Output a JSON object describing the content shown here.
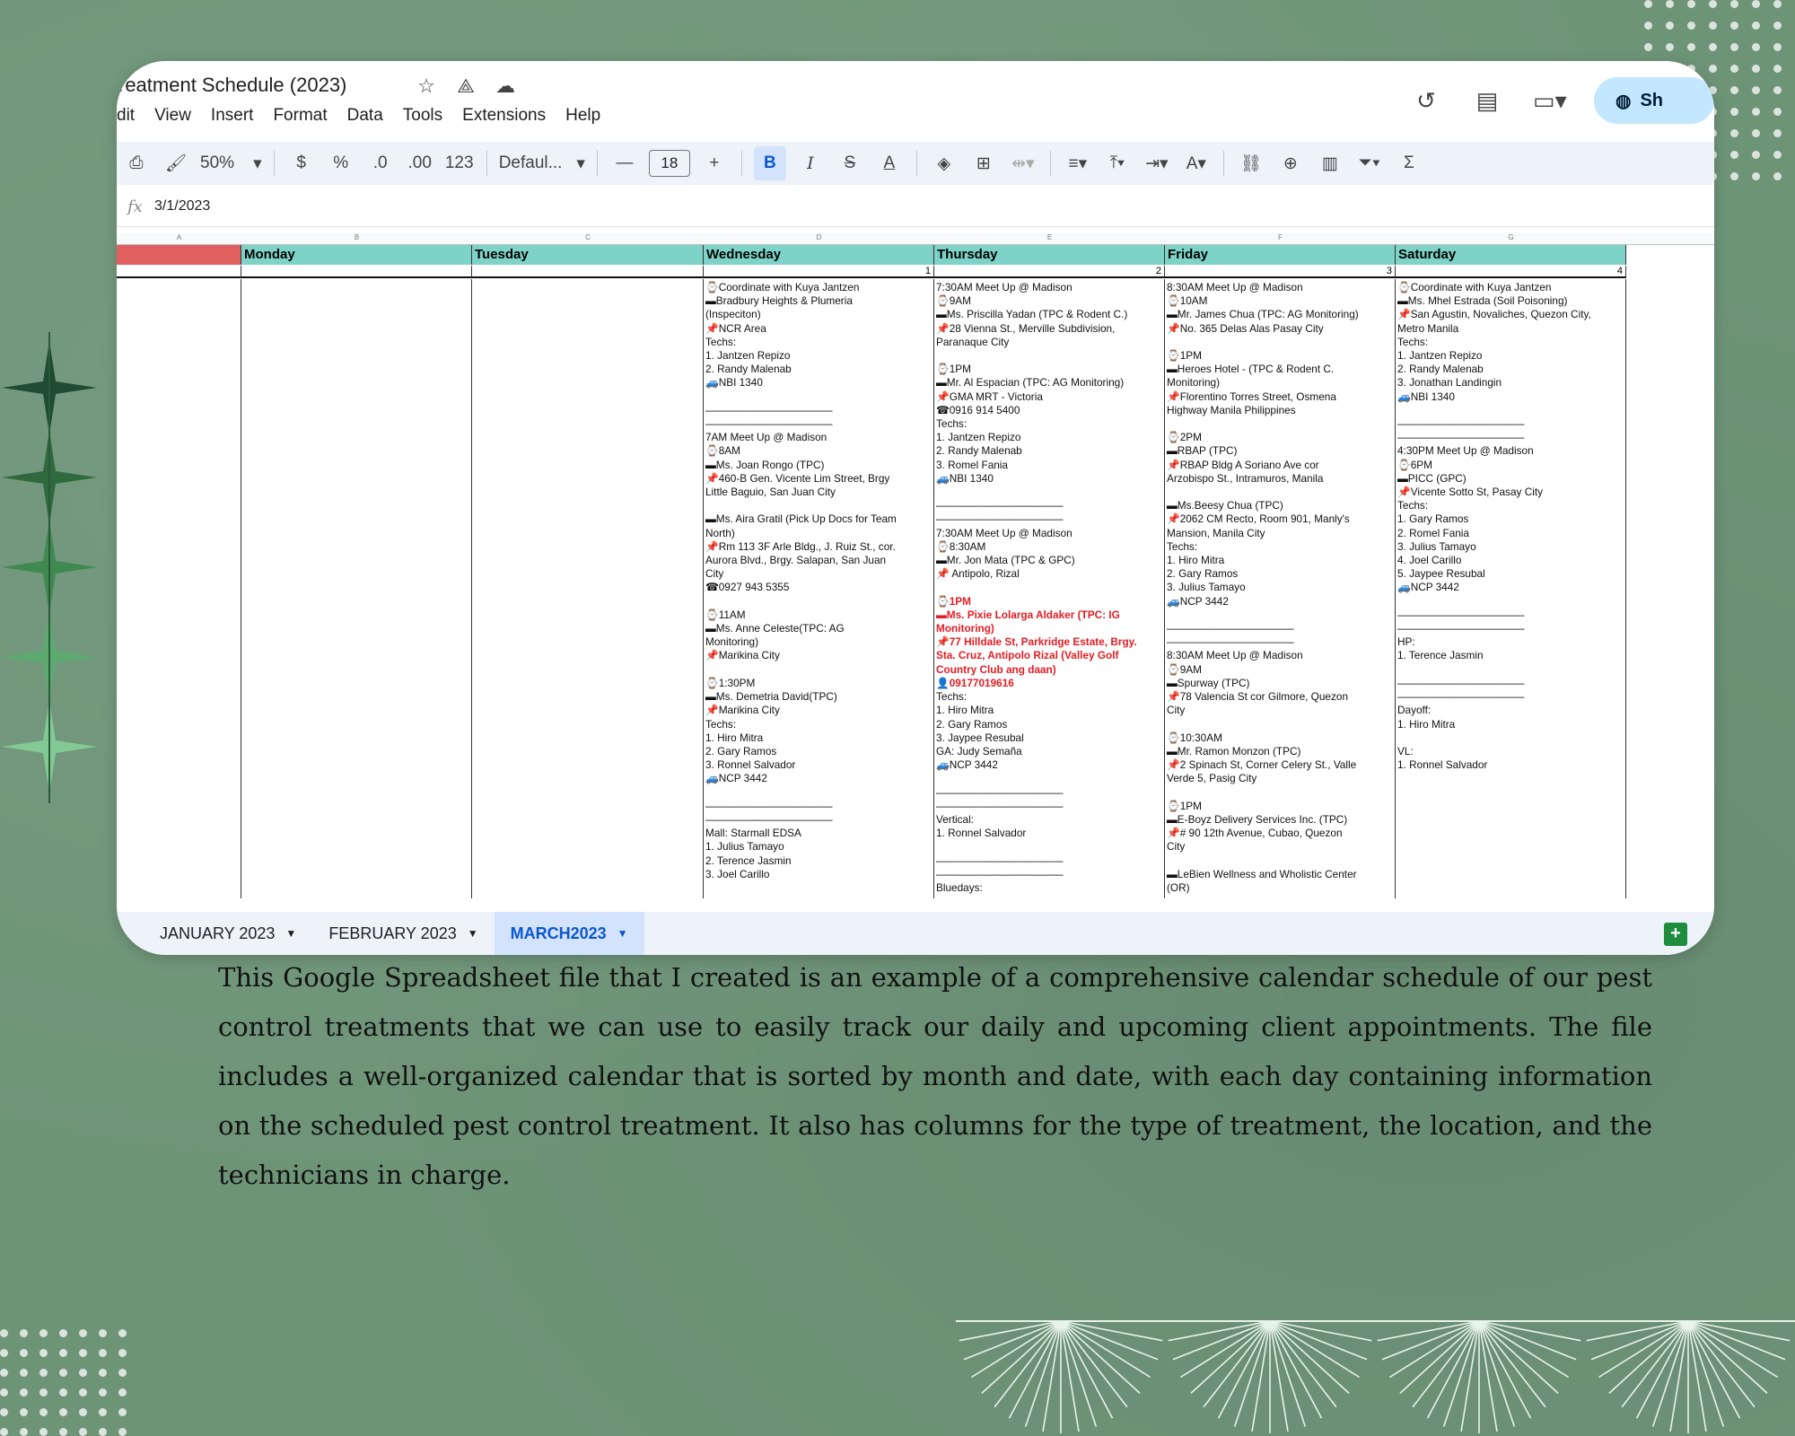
{
  "window": {
    "doc_title": "reatment Schedule (2023)",
    "menu": [
      "dit",
      "View",
      "Insert",
      "Format",
      "Data",
      "Tools",
      "Extensions",
      "Help"
    ],
    "share_label": "Sh"
  },
  "toolbar": {
    "zoom": "50%",
    "currency": "$",
    "percent": "%",
    "dec_decrease": ".0",
    "dec_increase": ".00",
    "number_format": "123",
    "font": "Defaul...",
    "font_size": "18"
  },
  "formula_bar": {
    "fx": "fx",
    "value": "3/1/2023"
  },
  "grid": {
    "column_letters": [
      "A",
      "B",
      "C",
      "D",
      "E",
      "F",
      "G"
    ],
    "days": [
      "",
      "Monday",
      "Tuesday",
      "Wednesday",
      "Thursday",
      "Friday",
      "Saturday"
    ],
    "dates": [
      "",
      "",
      "",
      "1",
      "2",
      "3",
      "4"
    ],
    "cells": {
      "wednesday": [
        "⌚Coordinate with Kuya Jantzen",
        "▬Bradbury Heights & Plumeria",
        "(Inspeciton)",
        "📌NCR Area",
        "Techs:",
        "1. Jantzen Repizo",
        "2. Randy Malenab",
        "🚙NBI 1340",
        "",
        "————————————",
        "————————————",
        "7AM Meet Up @ Madison",
        "⌚8AM",
        "▬Ms. Joan Rongo (TPC)",
        "📌460-B Gen. Vicente Lim Street, Brgy",
        "Little Baguio, San Juan City",
        "",
        "▬Ms. Aira Gratil (Pick Up Docs for Team",
        "North)",
        "📌Rm 113 3F Arle Bldg., J. Ruiz St., cor.",
        "Aurora Blvd., Brgy. Salapan, San Juan",
        "City",
        "☎0927 943 5355",
        "",
        "⌚11AM",
        "▬Ms. Anne Celeste(TPC: AG",
        "Monitoring)",
        "📌Marikina City",
        "",
        "⌚1:30PM",
        "▬Ms. Demetria David(TPC)",
        "📌Marikina City",
        "Techs:",
        "1. Hiro Mitra",
        "2. Gary Ramos",
        "3. Ronnel Salvador",
        "🚙NCP 3442",
        "",
        "————————————",
        "————————————",
        "Mall: Starmall EDSA",
        "1. Julius Tamayo",
        "2. Terence Jasmin",
        "3. Joel Carillo"
      ],
      "thursday": [
        "7:30AM Meet Up @ Madison",
        "⌚9AM",
        "▬Ms. Priscilla Yadan (TPC & Rodent C.)",
        "📌28 Vienna St., Merville Subdivision,",
        "Paranaque City",
        "",
        "⌚1PM",
        "▬Mr. Al Espacian (TPC: AG Monitoring)",
        "📌GMA MRT - Victoria",
        "☎0916 914 5400",
        "Techs:",
        "1. Jantzen Repizo",
        "2. Randy Malenab",
        "3. Romel Fania",
        "🚙NBI 1340",
        "",
        "————————————",
        "————————————",
        "7:30AM Meet Up @ Madison",
        "⌚8:30AM",
        "▬Mr. Jon Mata (TPC & GPC)",
        "📌 Antipolo, Rizal",
        "",
        "⌚1PM",
        "▬Ms. Pixie Lolarga Aldaker (TPC: IG",
        "Monitoring)",
        "📌77 Hilldale St, Parkridge Estate, Brgy.",
        "Sta. Cruz, Antipolo Rizal (Valley Golf",
        "Country Club ang daan)",
        "👤09177019616",
        "Techs:",
        "1. Hiro Mitra",
        "2. Gary Ramos",
        "3. Jaypee Resubal",
        "GA: Judy Semaña",
        "🚙NCP 3442",
        "",
        "————————————",
        "————————————",
        "Vertical:",
        "1. Ronnel Salvador",
        "",
        "————————————",
        "————————————",
        "Bluedays:"
      ],
      "thursday_red_from": 23,
      "thursday_red_to": 29,
      "friday": [
        "8:30AM Meet Up @ Madison",
        "⌚10AM",
        "▬Mr. James Chua (TPC: AG Monitoring)",
        "📌No. 365 Delas Alas Pasay City",
        "",
        "⌚1PM",
        "▬Heroes Hotel - (TPC & Rodent C.",
        "Monitoring)",
        "📌Florentino Torres Street, Osmena",
        "Highway Manila Philippines",
        "",
        "⌚2PM",
        "▬RBAP (TPC)",
        "📌RBAP Bldg A Soriano Ave cor",
        "Arzobispo St., Intramuros, Manila",
        "",
        "▬Ms.Beesy Chua (TPC)",
        "📌2062 CM Recto, Room 901, Manly's",
        "Mansion, Manila City",
        "Techs:",
        "1. Hiro Mitra",
        "2. Gary Ramos",
        "3. Julius Tamayo",
        "🚙NCP 3442",
        "",
        "————————————",
        "————————————",
        "8:30AM Meet Up @ Madison",
        "⌚9AM",
        "▬Spurway (TPC)",
        "📌78 Valencia St cor Gilmore, Quezon",
        "City",
        "",
        "⌚10:30AM",
        "▬Mr. Ramon Monzon (TPC)",
        "📌2 Spinach St, Corner Celery St., Valle",
        "Verde 5, Pasig City",
        "",
        "⌚1PM",
        "▬E-Boyz Delivery Services Inc. (TPC)",
        "📌# 90 12th Avenue, Cubao, Quezon",
        "City",
        "",
        "▬LeBien Wellness and Wholistic Center",
        "(OR)"
      ],
      "saturday": [
        "⌚Coordinate with Kuya Jantzen",
        "▬Ms. Mhel Estrada (Soil Poisoning)",
        "📌San Agustin, Novaliches, Quezon City,",
        "Metro Manila",
        "Techs:",
        "1. Jantzen Repizo",
        "2. Randy Malenab",
        "3. Jonathan Landingin",
        "🚙NBI 1340",
        "",
        "————————————",
        "————————————",
        "4:30PM Meet Up @ Madison",
        "⌚6PM",
        "▬PICC (GPC)",
        "📌Vicente Sotto St, Pasay City",
        "Techs:",
        "1. Gary Ramos",
        "2. Romel Fania",
        "3. Julius Tamayo",
        "4. Joel Carillo",
        "5. Jaypee Resubal",
        "🚙NCP 3442",
        "",
        "————————————",
        "————————————",
        "HP:",
        "1. Terence Jasmin",
        "",
        "————————————",
        "————————————",
        "Dayoff:",
        "1. Hiro Mitra",
        "",
        "VL:",
        "1. Ronnel Salvador"
      ]
    }
  },
  "sheet_tabs": [
    {
      "label": "JANUARY 2023",
      "active": false
    },
    {
      "label": "FEBRUARY 2023",
      "active": false
    },
    {
      "label": "MARCH2023",
      "active": true
    }
  ],
  "description": "This Google Spreadsheet file that I created is an example of a comprehensive calendar schedule of our pest control treatments that we can use to easily track our daily and upcoming client appointments. The file includes a well-organized calendar that is sorted by month and date, with each day containing information on the scheduled pest control treatment. It also has columns for the type of treatment, the location, and the technicians in charge.",
  "colors": {
    "background": "#6e9478",
    "day_header": "#7dd3c7",
    "col_a_header": "#e06060",
    "active_tab": "#0b57d0",
    "highlight_text": "#e51c23"
  },
  "icons": {
    "title": [
      "star-icon",
      "move-to-drive-icon",
      "cloud-status-icon"
    ],
    "right": [
      "history-icon",
      "comment-icon",
      "meet-video-icon",
      "globe-icon"
    ]
  }
}
